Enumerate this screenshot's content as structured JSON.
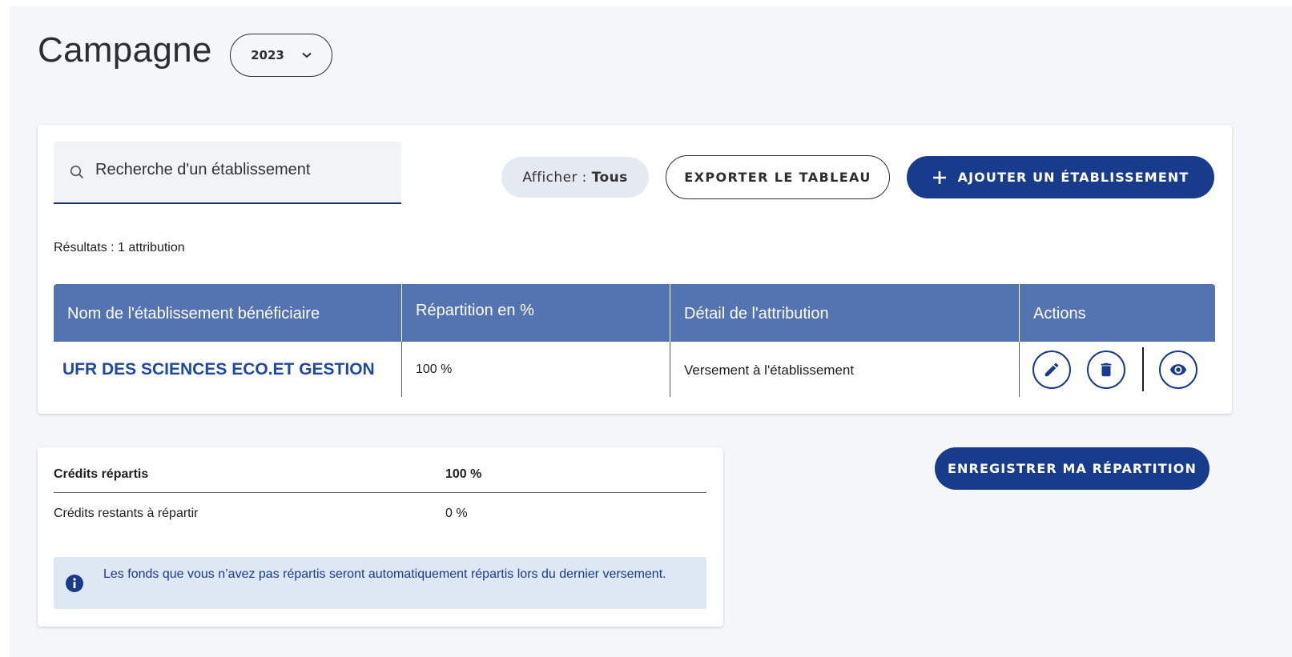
{
  "header": {
    "title": "Campagne",
    "year_selected": "2023"
  },
  "toolbar": {
    "search_placeholder": "Recherche d'un établissement",
    "filter_label": "Afficher :",
    "filter_value": "Tous",
    "export_label": "EXPORTER LE TABLEAU",
    "add_label": "AJOUTER UN ÉTABLISSEMENT"
  },
  "results_text": "Résultats : 1 attribution",
  "table": {
    "columns": [
      "Nom de l'établissement bénéficiaire",
      "Répartition en %",
      "Détail de l'attribution",
      "Actions"
    ],
    "rows": [
      {
        "name": "UFR DES SCIENCES ECO.ET GESTION",
        "repartition": "100 %",
        "detail": "Versement à l'établissement"
      }
    ]
  },
  "credits": {
    "distributed_label": "Crédits répartis",
    "distributed_value": "100 %",
    "remaining_label": "Crédits restants à répartir",
    "remaining_value": "0 %",
    "info_text": "Les fonds que vous n’avez pas répartis seront automatiquement répartis lors du dernier versement."
  },
  "save_label": "ENREGISTRER MA RÉPARTITION",
  "icons": {
    "year_dropdown": "chevron-down-icon",
    "search": "search-icon",
    "add": "plus-icon",
    "edit": "pencil-icon",
    "delete": "trash-icon",
    "view": "eye-icon",
    "info": "info-icon"
  },
  "colors": {
    "primary": "#183b8c",
    "table_header": "#5473b1",
    "link": "#1f4aa0",
    "page_background": "#f4f6fa",
    "info_background": "#dde8f4",
    "filter_chip": "#e5e9f2"
  }
}
